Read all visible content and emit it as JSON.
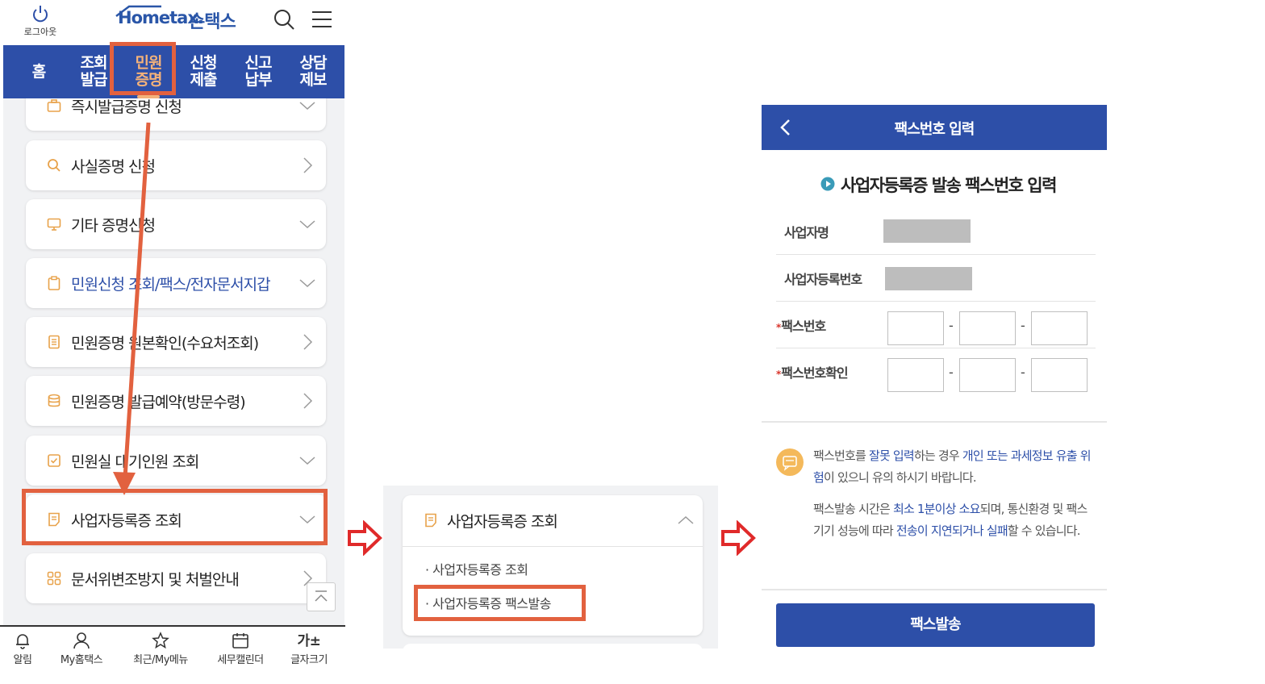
{
  "panel1": {
    "logout_label": "로그아웃",
    "brand_logo": "Hometax.",
    "brand_name": "손택스",
    "nav": [
      {
        "line1": "홈",
        "line2": ""
      },
      {
        "line1": "조회",
        "line2": "발급"
      },
      {
        "line1": "민원",
        "line2": "증명"
      },
      {
        "line1": "신청",
        "line2": "제출"
      },
      {
        "line1": "신고",
        "line2": "납부"
      },
      {
        "line1": "상담",
        "line2": "제보"
      }
    ],
    "items": [
      {
        "label": "즉시발급증명 신청",
        "icon": "briefcase-icon",
        "chevron": "down"
      },
      {
        "label": "사실증명 신청",
        "icon": "search-icon",
        "chevron": "right"
      },
      {
        "label": "기타 증명신청",
        "icon": "monitor-icon",
        "chevron": "down"
      },
      {
        "label": "민원신청 조회/팩스/전자문서지갑",
        "icon": "clipboard-icon",
        "chevron": "down"
      },
      {
        "label": "민원증명 원본확인(수요처조회)",
        "icon": "document-icon",
        "chevron": "right"
      },
      {
        "label": "민원증명 발급예약(방문수령)",
        "icon": "database-icon",
        "chevron": "right"
      },
      {
        "label": "민원실 대기인원 조회",
        "icon": "checkbox-icon",
        "chevron": "down"
      },
      {
        "label": "사업자등록증 조회",
        "icon": "document-icon",
        "chevron": "down"
      },
      {
        "label": "문서위변조방지 및 처벌안내",
        "icon": "grid-icon",
        "chevron": "right"
      }
    ],
    "bottom_nav": [
      "알림",
      "My홈택스",
      "최근/My메뉴",
      "세무캘린더",
      "글자크기"
    ],
    "font_size_glyph": "가±"
  },
  "panel2": {
    "title": "사업자등록증 조회",
    "sub_items": [
      "사업자등록증 조회",
      "사업자등록증 팩스발송"
    ]
  },
  "panel3": {
    "header_title": "팩스번호 입력",
    "section_title": "사업자등록증 발송 팩스번호 입력",
    "rows": [
      {
        "label": "사업자명"
      },
      {
        "label": "사업자등록번호"
      },
      {
        "label": "팩스번호",
        "required_mark": "*",
        "separator": "-"
      },
      {
        "label": "팩스번호확인",
        "required_mark": "*",
        "separator": "-"
      }
    ],
    "notice1": {
      "p1": "팩스번호를 ",
      "p2": "잘못 입력",
      "p3": "하는 경우 ",
      "p4": "개인 또는 과세정보 유출 위험",
      "p5": "이 있으니 유의 하시기 바랍니다."
    },
    "notice2": {
      "p1": "팩스발송 시간은 ",
      "p2": "최소 1분이상 소요",
      "p3": "되며, 통신환경 및 팩스기기 성능에 따라 ",
      "p4": "전송이 지연되거나 실패",
      "p5": "할 수 있습니다."
    },
    "button_label": "팩스발송"
  },
  "colors": {
    "brand_blue": "#2d4fa8",
    "highlight_red": "#e2613f",
    "active_tab": "#f4b27a",
    "notice_icon": "#f4b95b"
  }
}
